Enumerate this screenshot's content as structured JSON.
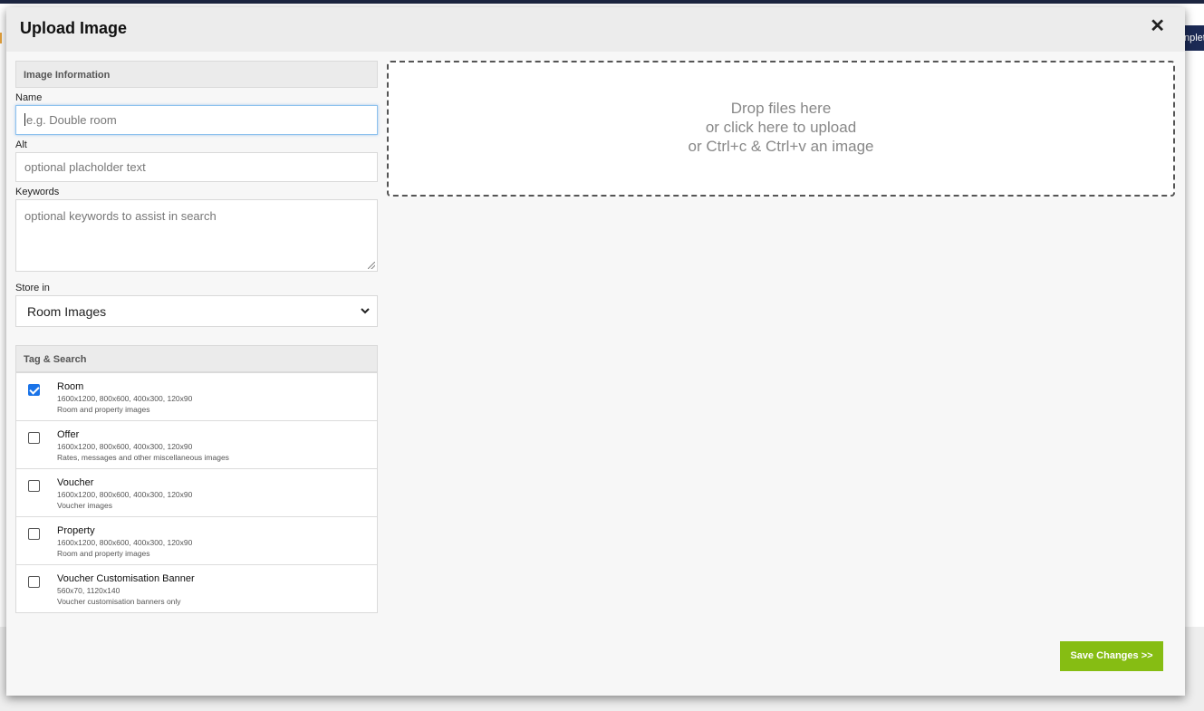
{
  "background": {
    "right_button_label": "nplet"
  },
  "modal": {
    "title": "Upload Image",
    "close_label": "✕"
  },
  "image_info": {
    "heading": "Image Information",
    "name_label": "Name",
    "name_placeholder": "e.g. Double room",
    "alt_label": "Alt",
    "alt_placeholder": "optional placholder text",
    "keywords_label": "Keywords",
    "keywords_placeholder": "optional keywords to assist in search",
    "store_label": "Store in",
    "store_value": "Room Images"
  },
  "tag_search": {
    "heading": "Tag & Search",
    "items": [
      {
        "name": "Room",
        "sizes": "1600x1200, 800x600, 400x300, 120x90",
        "desc": "Room and property images",
        "checked": true
      },
      {
        "name": "Offer",
        "sizes": "1600x1200, 800x600, 400x300, 120x90",
        "desc": "Rates, messages and other miscellaneous images",
        "checked": false
      },
      {
        "name": "Voucher",
        "sizes": "1600x1200, 800x600, 400x300, 120x90",
        "desc": "Voucher images",
        "checked": false
      },
      {
        "name": "Property",
        "sizes": "1600x1200, 800x600, 400x300, 120x90",
        "desc": "Room and property images",
        "checked": false
      },
      {
        "name": "Voucher Customisation Banner",
        "sizes": "560x70, 1120x140",
        "desc": "Voucher customisation banners only",
        "checked": false
      }
    ]
  },
  "dropzone": {
    "line1": "Drop files here",
    "line2": "or click here to upload",
    "line3": "or Ctrl+c & Ctrl+v an image"
  },
  "footer": {
    "save_label": "Save Changes >>"
  },
  "colors": {
    "accent": "#86bd13",
    "checkbox": "#1a73e8",
    "header": "#ececec"
  }
}
